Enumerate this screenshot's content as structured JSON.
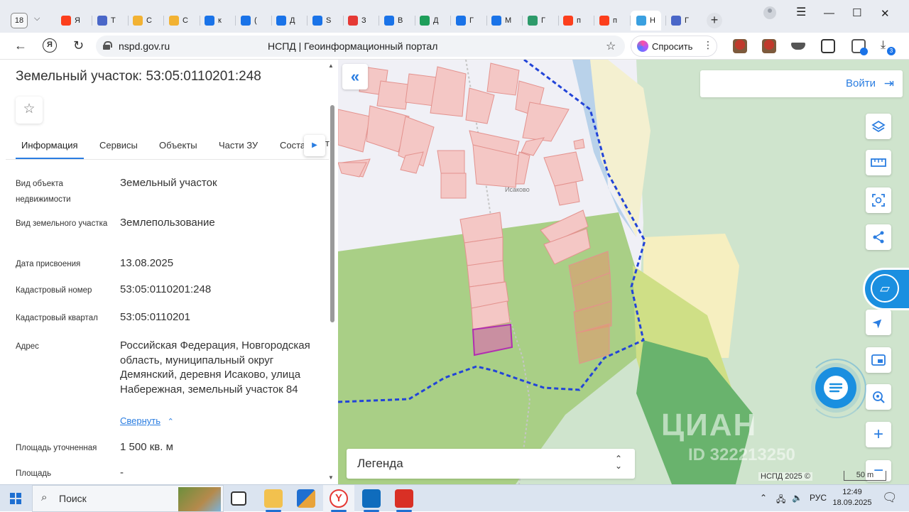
{
  "browser": {
    "tab_count": "18",
    "tabs": [
      {
        "label": "Я",
        "icon": "yandex-icon",
        "color": "#fc3f1d"
      },
      {
        "label": "Т",
        "icon": "emblem-icon",
        "color": "#4a67c8"
      },
      {
        "label": "С",
        "icon": "check-icon",
        "color": "#f2b233"
      },
      {
        "label": "С",
        "icon": "check-icon",
        "color": "#f2b233"
      },
      {
        "label": "к",
        "icon": "at-icon",
        "color": "#1a73e8"
      },
      {
        "label": "(",
        "icon": "mail-icon",
        "color": "#1a73e8"
      },
      {
        "label": "Д",
        "icon": "doc-icon",
        "color": "#1a73e8"
      },
      {
        "label": "S",
        "icon": "image-icon",
        "color": "#1a73e8"
      },
      {
        "label": "З",
        "icon": "pdf-icon",
        "color": "#e53935"
      },
      {
        "label": "В",
        "icon": "image-icon",
        "color": "#1a73e8"
      },
      {
        "label": "Д",
        "icon": "doc-icon",
        "color": "#1e9e5a"
      },
      {
        "label": "Г",
        "icon": "mail-icon",
        "color": "#1a73e8"
      },
      {
        "label": "М",
        "icon": "at-icon",
        "color": "#1a73e8"
      },
      {
        "label": "Г",
        "icon": "star-icon",
        "color": "#2d9a6a"
      },
      {
        "label": "п",
        "icon": "yandex-icon",
        "color": "#fc3f1d"
      },
      {
        "label": "п",
        "icon": "yandex-icon",
        "color": "#fc3f1d"
      },
      {
        "label": "Н",
        "icon": "site-icon",
        "color": "#3aa0e0"
      },
      {
        "label": "Г",
        "icon": "emblem-icon",
        "color": "#4a67c8"
      }
    ],
    "domain": "nspd.gov.ru",
    "page_title": "НСПД | Геоинформационный портал",
    "ask_label": "Спросить",
    "download_badge": "3"
  },
  "panel": {
    "title": "Земельный участок: 53:05:0110201:248",
    "tabs": [
      "Информация",
      "Сервисы",
      "Объекты",
      "Части ЗУ",
      "Соста"
    ],
    "tab_overflow": "т",
    "fields": [
      {
        "label": "Вид объекта недвижимости",
        "value": "Земельный участок"
      },
      {
        "label": "Вид земельного участка",
        "value": "Землепользование"
      },
      {
        "label": "Дата присвоения",
        "value": "13.08.2025"
      },
      {
        "label": "Кадастровый номер",
        "value": "53:05:0110201:248"
      },
      {
        "label": "Кадастровый квартал",
        "value": "53:05:0110201"
      },
      {
        "label": "Адрес",
        "value": "Российская Федерация, Новгородская область, муниципальный округ Демянский, деревня Исаково, улица Набережная, земельный участок 84"
      },
      {
        "label": "Площадь уточненная",
        "value": "1 500 кв. м"
      },
      {
        "label": "Площадь",
        "value": "-"
      }
    ],
    "collapse_label": "Свернуть"
  },
  "map": {
    "login_label": "Войти",
    "legend_label": "Легенда",
    "attribution": "НСПД 2025 ©",
    "scale": "50 m",
    "village_label": "Исаково",
    "watermark": "ЦИАН",
    "watermark_id": "ID 322213250"
  },
  "taskbar": {
    "search_label": "Поиск",
    "language": "РУС",
    "time": "12:49",
    "date": "18.09.2025"
  }
}
